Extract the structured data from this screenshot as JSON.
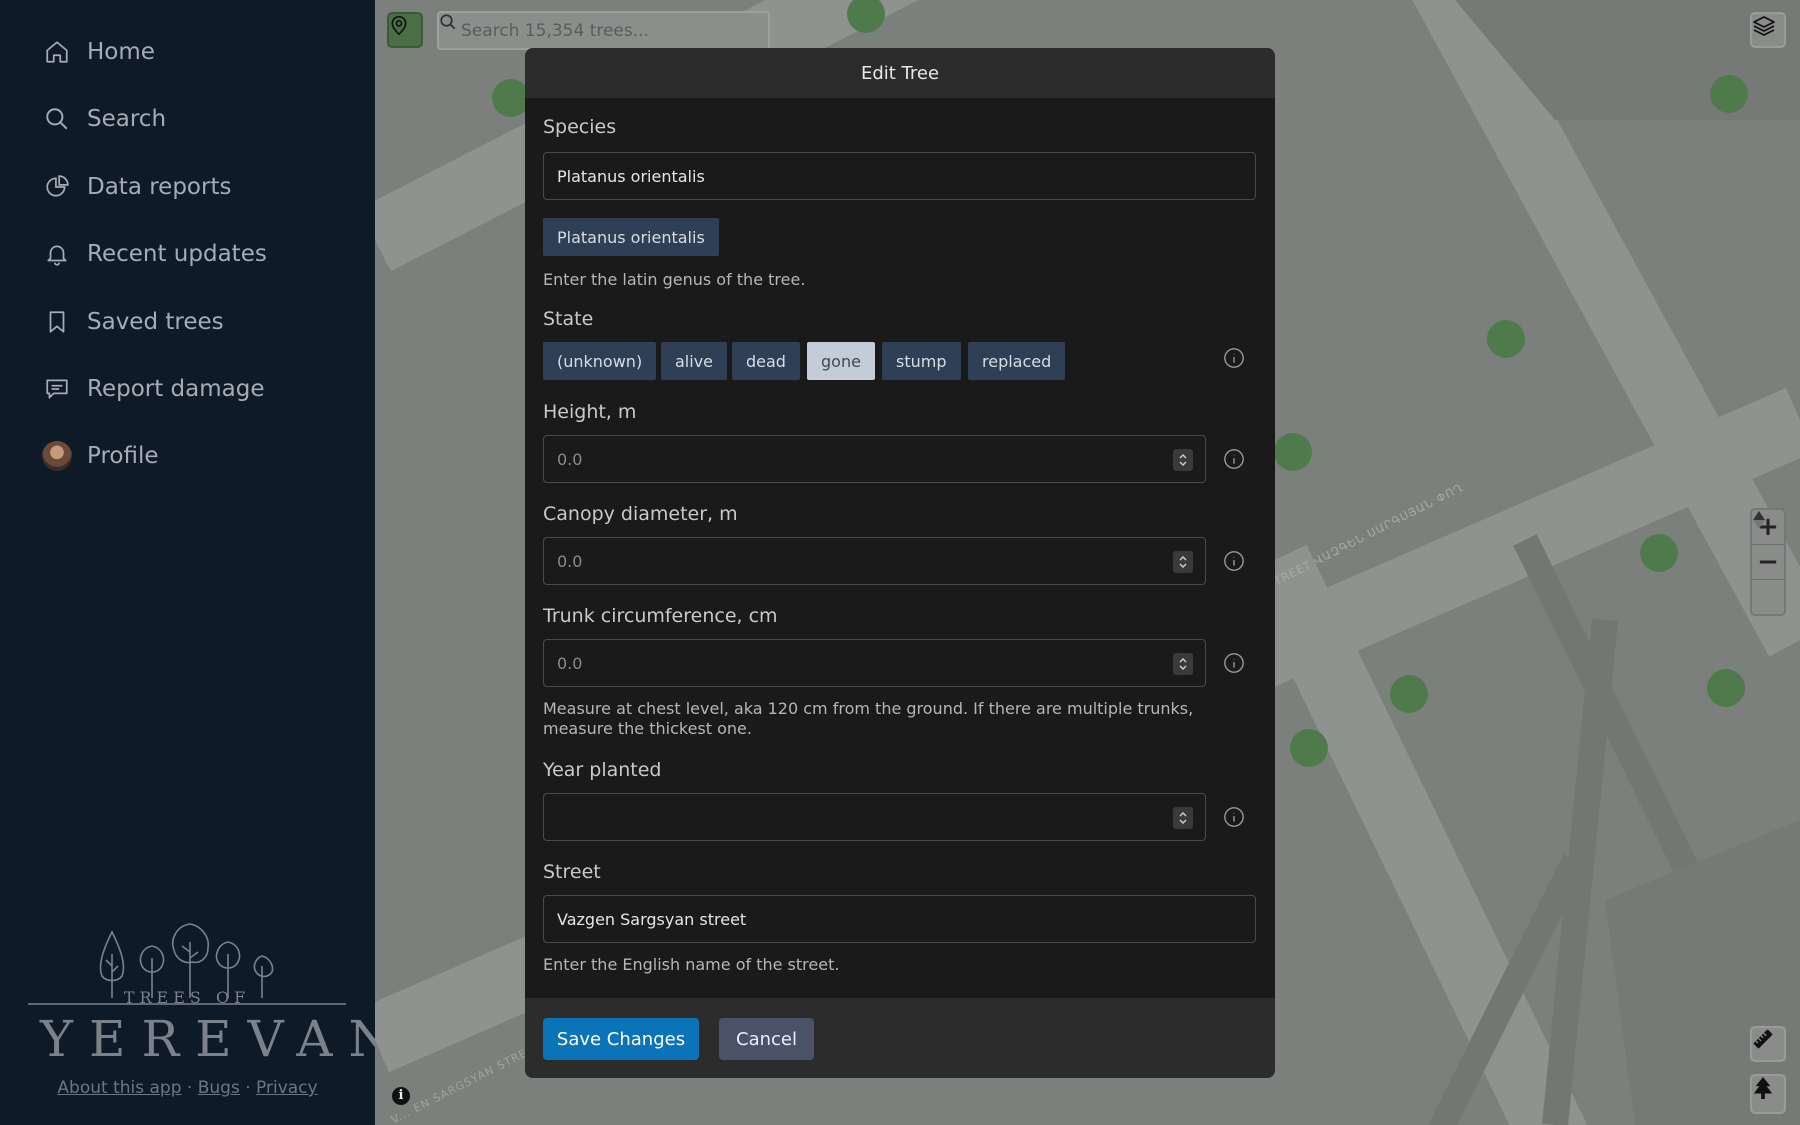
{
  "nav": {
    "items": [
      {
        "label": "Home",
        "icon": "home-icon"
      },
      {
        "label": "Search",
        "icon": "search-icon"
      },
      {
        "label": "Data reports",
        "icon": "pie-chart-icon"
      },
      {
        "label": "Recent updates",
        "icon": "bell-icon"
      },
      {
        "label": "Saved trees",
        "icon": "bookmark-icon"
      },
      {
        "label": "Report damage",
        "icon": "message-icon"
      },
      {
        "label": "Profile",
        "icon": "avatar"
      }
    ]
  },
  "brand": {
    "line1": "TREES OF",
    "line2": "YEREVAN"
  },
  "footer": {
    "about": "About this app",
    "sep1": " · ",
    "bugs": "Bugs",
    "sep2": " · ",
    "privacy": "Privacy"
  },
  "map": {
    "search_placeholder": "Search 15,354 trees...",
    "zoom_in": "+",
    "zoom_out": "−",
    "street_label_1": "STREET ՎԱԶԳԵՆ ՍԱՐԳՍՅԱՆ ՓՈՂ",
    "street_label_2": "V... EN SARGSYAN STRE..."
  },
  "modal": {
    "title": "Edit Tree",
    "species_label": "Species",
    "species_value": "Platanus orientalis",
    "species_suggestion": "Platanus orientalis",
    "species_help": "Enter the latin genus of the tree.",
    "state_label": "State",
    "states": [
      "(unknown)",
      "alive",
      "dead",
      "gone",
      "stump",
      "replaced"
    ],
    "state_selected": "gone",
    "height_label": "Height, m",
    "height_placeholder": "0.0",
    "canopy_label": "Canopy diameter, m",
    "canopy_placeholder": "0.0",
    "trunk_label": "Trunk circumference, cm",
    "trunk_placeholder": "0.0",
    "trunk_help": "Measure at chest level, aka 120 cm from the ground. If there are multiple trunks, measure the thickest one.",
    "year_label": "Year planted",
    "year_value": "",
    "street_label": "Street",
    "street_value": "Vazgen Sargsyan street",
    "street_help": "Enter the English name of the street.",
    "save_label": "Save Changes",
    "cancel_label": "Cancel"
  },
  "colors": {
    "sidebar_bg": "#0f1a29",
    "modal_bg": "#1a1a1a",
    "primary": "#0b73b8",
    "chip": "#2e3f56",
    "chip_active": "#c4ccd8",
    "tree_marker": "#4f7a4c"
  }
}
